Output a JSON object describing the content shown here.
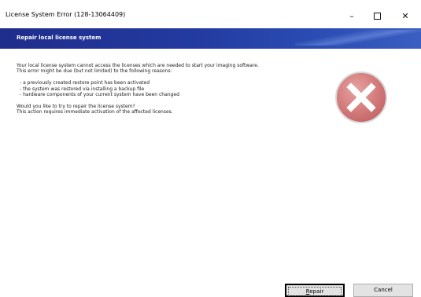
{
  "window": {
    "title": "License System Error (128-13064409)",
    "minimize_label": "–",
    "close_label": "✕"
  },
  "banner": {
    "title": "Repair local license system"
  },
  "message": {
    "line1": "Your local license system cannot access the licenses which are needed to start your imaging software.",
    "line2": "This error might be due (but not limited) to the following reasons:",
    "reasons": [
      "- a previously created restore point has been activated",
      "- the system was restored via installing a backup file",
      "- hardware components of your current system have been changed"
    ],
    "question": "Would you like to try to repair the license system?",
    "note": "This action requires immediate activation of the affected licenses."
  },
  "icon": "error-x-icon",
  "buttons": {
    "repair_accesskey": "R",
    "repair_rest": "epair",
    "cancel": "Cancel"
  },
  "colors": {
    "banner": "#1f2d8c",
    "icon_red": "#d37a7a"
  }
}
